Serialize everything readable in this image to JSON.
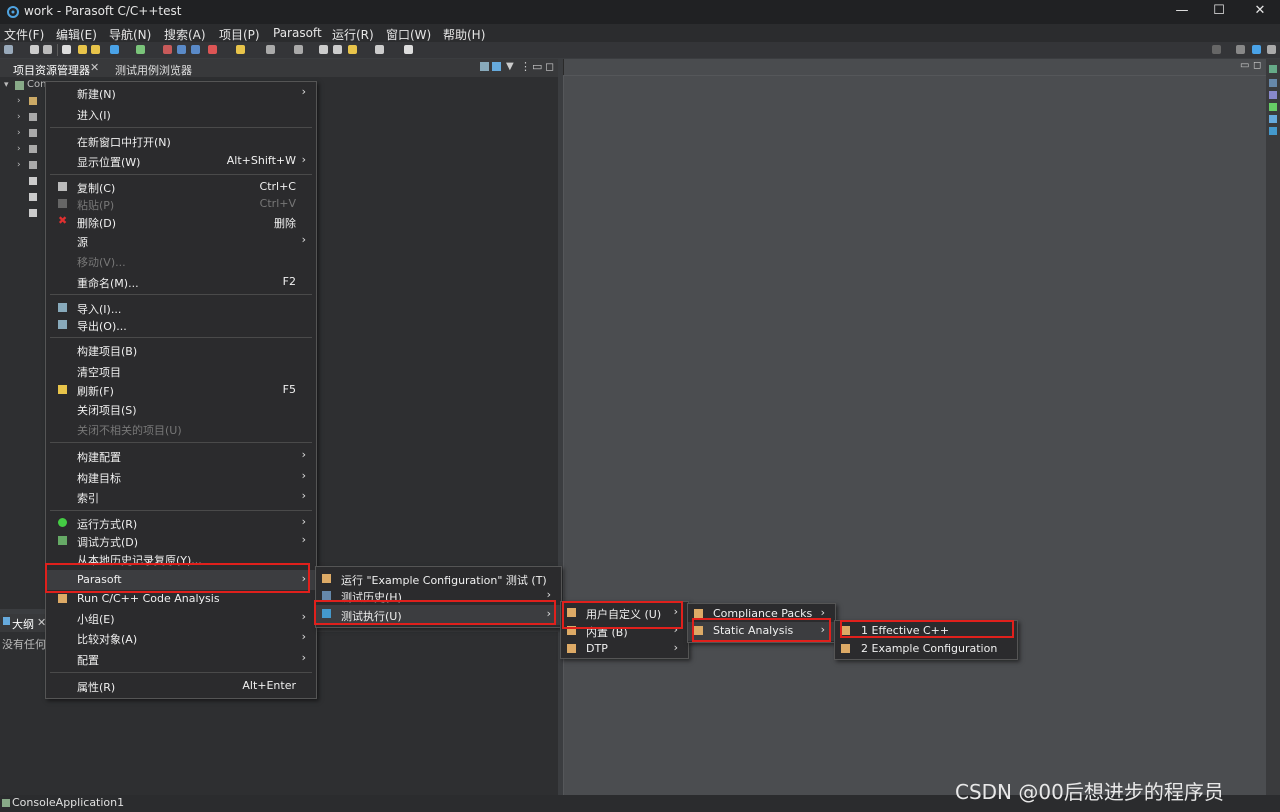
{
  "window": {
    "title": "work - Parasoft C/C++test",
    "minimize": "—",
    "maximize": "☐",
    "close": "✕"
  },
  "menubar": [
    "文件(F)",
    "编辑(E)",
    "导航(N)",
    "搜索(A)",
    "项目(P)",
    "Parasoft",
    "运行(R)",
    "窗口(W)",
    "帮助(H)"
  ],
  "tabs": {
    "project_explorer": "项目资源管理器",
    "test_case_browser": "测试用例浏览器",
    "outline": "大纲"
  },
  "tree": {
    "root": "Con"
  },
  "outline": {
    "empty_text": "没有任何"
  },
  "context_menu": {
    "new": "新建(N)",
    "go_into": "进入(I)",
    "open_new_window": "在新窗口中打开(N)",
    "show_in": "显示位置(W)",
    "show_in_sc": "Alt+Shift+W",
    "copy": "复制(C)",
    "copy_sc": "Ctrl+C",
    "paste": "粘贴(P)",
    "paste_sc": "Ctrl+V",
    "delete": "删除(D)",
    "delete_sc": "删除",
    "source": "源",
    "move": "移动(V)...",
    "rename": "重命名(M)...",
    "rename_sc": "F2",
    "import": "导入(I)...",
    "export": "导出(O)...",
    "build_project": "构建项目(B)",
    "clean_project": "清空项目",
    "refresh": "刷新(F)",
    "refresh_sc": "F5",
    "close_project": "关闭项目(S)",
    "close_unrelated": "关闭不相关的项目(U)",
    "build_config": "构建配置",
    "build_targets": "构建目标",
    "index": "索引",
    "run_as": "运行方式(R)",
    "debug_as": "调试方式(D)",
    "restore_history": "从本地历史记录复原(Y)...",
    "parasoft": "Parasoft",
    "run_code_analysis": "Run C/C++ Code Analysis",
    "team": "小组(E)",
    "compare_with": "比较对象(A)",
    "configure": "配置",
    "properties": "属性(R)",
    "properties_sc": "Alt+Enter"
  },
  "parasoft_menu": {
    "run_example": "运行 \"Example Configuration\" 测试 (T)",
    "test_history": "测试历史(H)",
    "test_using": "测试执行(U)"
  },
  "test_using_menu": {
    "user_defined": "用户自定义 (U)",
    "builtin": "内置 (B)",
    "dtp": "DTP"
  },
  "user_defined_menu": {
    "compliance_packs": "Compliance Packs",
    "static_analysis": "Static Analysis"
  },
  "static_analysis_menu": {
    "effective_cpp": "1 Effective C++",
    "example_config": "2 Example Configuration"
  },
  "status": {
    "selected": "ConsoleApplication1"
  },
  "watermark": "CSDN @00后想进步的程序员",
  "colors": {
    "highlight": "#e0201c",
    "menu_bg": "#2b2b2d"
  }
}
